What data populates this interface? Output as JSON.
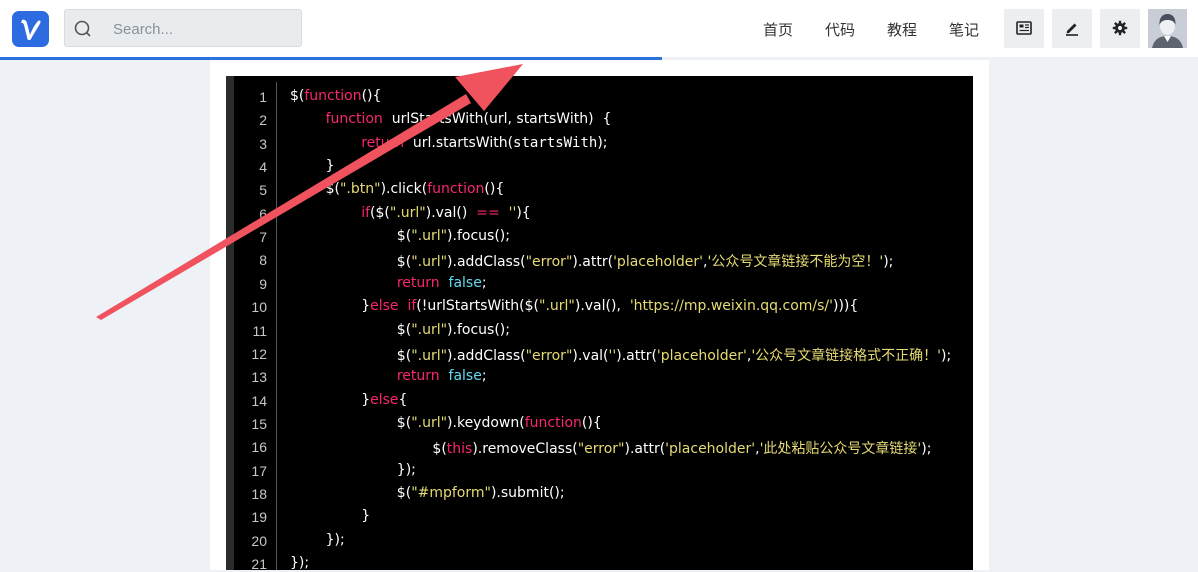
{
  "header": {
    "search_placeholder": "Search...",
    "nav": [
      "首页",
      "代码",
      "教程",
      "笔记"
    ],
    "tools": [
      "news-icon",
      "edit-icon",
      "gear-icon"
    ],
    "accent": "#2a72e0",
    "page_load_progress": 0.553
  },
  "code": {
    "line_numbers": [
      "1",
      "2",
      "3",
      "4",
      "5",
      "6",
      "7",
      "8",
      "9",
      "10",
      "11",
      "12",
      "13",
      "14",
      "15",
      "16",
      "17",
      "18",
      "19",
      "20",
      "21"
    ],
    "lines": [
      [
        [
          "p",
          "$("
        ],
        [
          "k",
          "function"
        ],
        [
          "p",
          "(){"
        ]
      ],
      [
        [
          "p",
          "        "
        ],
        [
          "k",
          "function"
        ],
        [
          "p",
          "  urlStartsWith(url, startsWith)  {"
        ]
      ],
      [
        [
          "p",
          "                "
        ],
        [
          "k",
          "return"
        ],
        [
          "p",
          "  url.startsWith("
        ],
        [
          "m",
          "startsWith"
        ],
        [
          "p",
          ");"
        ]
      ],
      [
        [
          "p",
          "        }"
        ]
      ],
      [
        [
          "p",
          "        $("
        ],
        [
          "s",
          "\".btn\""
        ],
        [
          "p",
          ").click("
        ],
        [
          "k",
          "function"
        ],
        [
          "p",
          "(){"
        ]
      ],
      [
        [
          "p",
          "                "
        ],
        [
          "k",
          "if"
        ],
        [
          "p",
          "($("
        ],
        [
          "s",
          "\".url\""
        ],
        [
          "p",
          ").val()  "
        ],
        [
          "k",
          "=="
        ],
        [
          "p",
          "  "
        ],
        [
          "s",
          "''"
        ],
        [
          "p",
          "){"
        ]
      ],
      [
        [
          "p",
          "                        $("
        ],
        [
          "s",
          "\".url\""
        ],
        [
          "p",
          ").focus();"
        ]
      ],
      [
        [
          "p",
          "                        $("
        ],
        [
          "s",
          "\".url\""
        ],
        [
          "p",
          ").addClass("
        ],
        [
          "s",
          "\"error\""
        ],
        [
          "p",
          ").attr("
        ],
        [
          "s",
          "'placeholder'"
        ],
        [
          "p",
          ","
        ],
        [
          "s",
          "'公众号文章链接不能为空！'"
        ],
        [
          "p",
          ");"
        ]
      ],
      [
        [
          "p",
          "                        "
        ],
        [
          "k",
          "return"
        ],
        [
          "p",
          "  "
        ],
        [
          "v",
          "false"
        ],
        [
          "p",
          ";"
        ]
      ],
      [
        [
          "p",
          "                }"
        ],
        [
          "k",
          "else"
        ],
        [
          "p",
          "  "
        ],
        [
          "k",
          "if"
        ],
        [
          "p",
          "(!urlStartsWith($("
        ],
        [
          "s",
          "\".url\""
        ],
        [
          "p",
          ").val(),  "
        ],
        [
          "s",
          "'https://mp.weixin.qq.com/s/'"
        ],
        [
          "p",
          "))){"
        ]
      ],
      [
        [
          "p",
          "                        $("
        ],
        [
          "s",
          "\".url\""
        ],
        [
          "p",
          ").focus();"
        ]
      ],
      [
        [
          "p",
          "                        $("
        ],
        [
          "s",
          "\".url\""
        ],
        [
          "p",
          ").addClass("
        ],
        [
          "s",
          "\"error\""
        ],
        [
          "p",
          ").val("
        ],
        [
          "s",
          "''"
        ],
        [
          "p",
          ").attr("
        ],
        [
          "s",
          "'placeholder'"
        ],
        [
          "p",
          ","
        ],
        [
          "s",
          "'公众号文章链接格式不正确！'"
        ],
        [
          "p",
          ");"
        ]
      ],
      [
        [
          "p",
          "                        "
        ],
        [
          "k",
          "return"
        ],
        [
          "p",
          "  "
        ],
        [
          "v",
          "false"
        ],
        [
          "p",
          ";"
        ]
      ],
      [
        [
          "p",
          "                }"
        ],
        [
          "k",
          "else"
        ],
        [
          "p",
          "{"
        ]
      ],
      [
        [
          "p",
          "                        $("
        ],
        [
          "s",
          "\".url\""
        ],
        [
          "p",
          ").keydown("
        ],
        [
          "k",
          "function"
        ],
        [
          "p",
          "(){"
        ]
      ],
      [
        [
          "p",
          "                                $("
        ],
        [
          "k",
          "this"
        ],
        [
          "p",
          ").removeClass("
        ],
        [
          "s",
          "\"error\""
        ],
        [
          "p",
          ").attr("
        ],
        [
          "s",
          "'placeholder'"
        ],
        [
          "p",
          ","
        ],
        [
          "s",
          "'此处粘贴公众号文章链接'"
        ],
        [
          "p",
          ");"
        ]
      ],
      [
        [
          "p",
          "                        });"
        ]
      ],
      [
        [
          "p",
          "                        $("
        ],
        [
          "s",
          "\"#mpform\""
        ],
        [
          "p",
          ").submit();"
        ]
      ],
      [
        [
          "p",
          "                }"
        ]
      ],
      [
        [
          "p",
          "        });"
        ]
      ],
      [
        [
          "p",
          "});"
        ]
      ]
    ]
  },
  "overlay": {
    "annotation_arrow_color": "#f0525e"
  }
}
